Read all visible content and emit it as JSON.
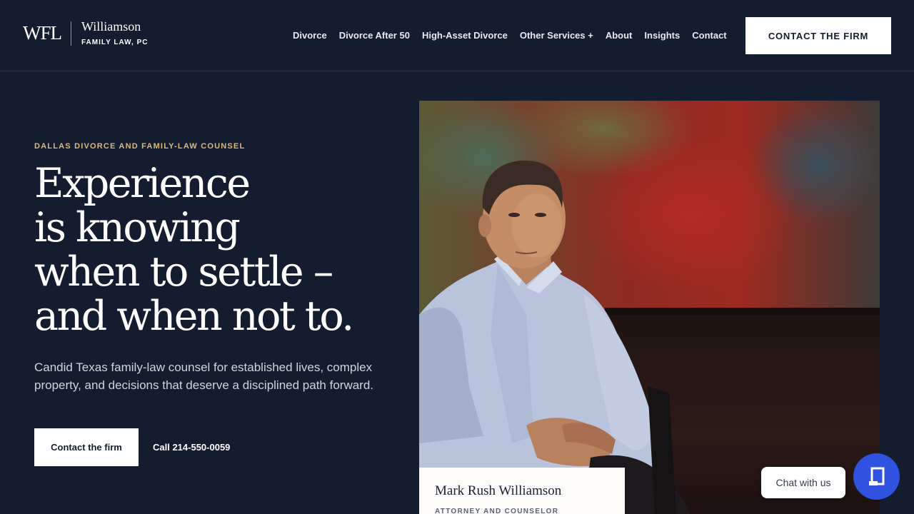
{
  "brand": {
    "mark": "WFL",
    "name": "Williamson",
    "sub": "FAMILY LAW, PC"
  },
  "nav": {
    "items": [
      {
        "label": "Divorce"
      },
      {
        "label": "Divorce After 50"
      },
      {
        "label": "High-Asset Divorce"
      },
      {
        "label": "Other Services +"
      },
      {
        "label": "About"
      },
      {
        "label": "Insights"
      },
      {
        "label": "Contact"
      }
    ],
    "cta_label": "CONTACT THE FIRM"
  },
  "hero": {
    "eyebrow": "DALLAS DIVORCE AND FAMILY-LAW COUNSEL",
    "headline_lines": [
      "Experience",
      "is knowing",
      "when to settle –",
      "and when not to."
    ],
    "lede": "Candid Texas family-law counsel for established lives, complex property, and decisions that deserve a disciplined path forward.",
    "primary_button": "Contact the firm",
    "call_link": "Call 214-550-0059"
  },
  "portrait": {
    "name": "Mark Rush Williamson",
    "role": "ATTORNEY AND COUNSELOR"
  },
  "chat": {
    "label": "Chat with us",
    "icon": "chat-icon"
  },
  "colors": {
    "background": "#141c2f",
    "accent": "#d9b97c",
    "chat": "#2f52e0"
  }
}
